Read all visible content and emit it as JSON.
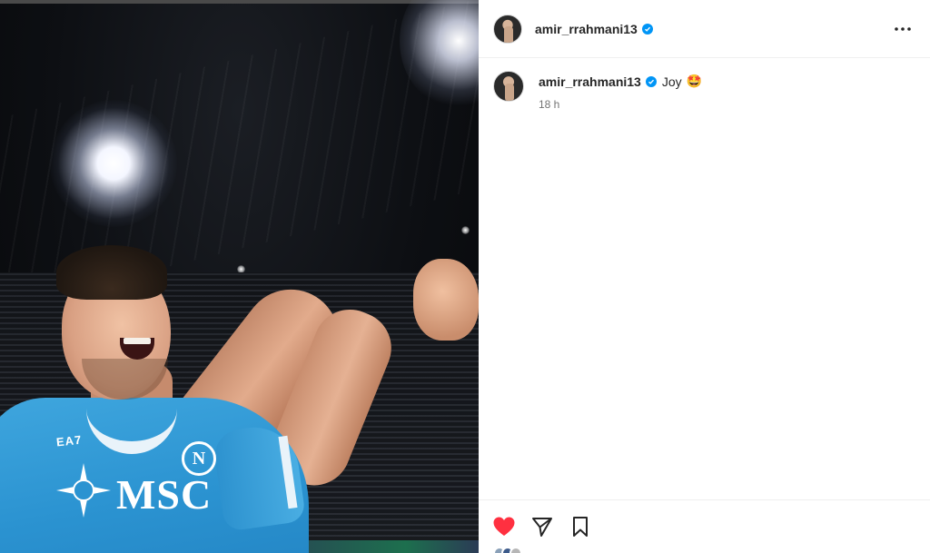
{
  "post": {
    "image": {
      "description_icon": "football-celebration-photo",
      "jersey_sponsor": "MSC",
      "kit_brand": "EA7",
      "crest_letter": "N"
    },
    "header": {
      "username": "amir_rrahmani13",
      "verified": true,
      "more_icon": "more-horizontal-icon"
    },
    "caption": {
      "username": "amir_rrahmani13",
      "text": "Joy",
      "emoji": "🤩",
      "timestamp": "18 h"
    },
    "actions": {
      "liked": true,
      "like_icon": "heart-filled-icon",
      "share_icon": "paper-plane-icon",
      "save_icon": "bookmark-icon"
    }
  },
  "colors": {
    "like_red": "#ff3040",
    "verified_blue": "#0095f6",
    "jersey_blue": "#2b93d1",
    "text_primary": "#262626",
    "text_secondary": "#737373"
  }
}
